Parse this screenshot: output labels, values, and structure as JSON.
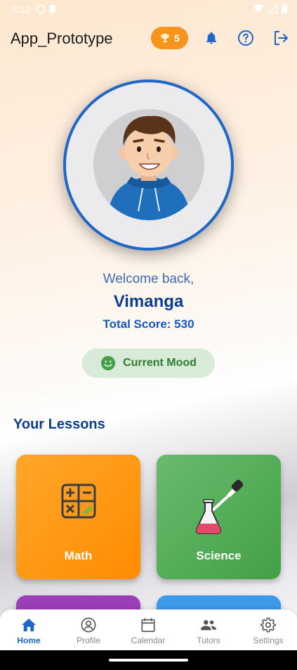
{
  "status_bar": {
    "time": "6:12"
  },
  "app_bar": {
    "title": "App_Prototype",
    "trophy_count": "5"
  },
  "profile": {
    "welcome_text": "Welcome back,",
    "username": "Vimanga",
    "total_score": "Total Score: 530"
  },
  "mood": {
    "label": "Current Mood"
  },
  "lessons": {
    "section_title": "Your Lessons",
    "items": [
      {
        "label": "Math",
        "color": "#ff9800"
      },
      {
        "label": "Science",
        "color": "#4caf50"
      }
    ]
  },
  "bottom_nav": {
    "items": [
      {
        "label": "Home",
        "icon": "home-icon",
        "active": true
      },
      {
        "label": "Profile",
        "icon": "account-circle-icon"
      },
      {
        "label": "Calendar",
        "icon": "calendar-icon"
      },
      {
        "label": "Tutors",
        "icon": "people-icon"
      },
      {
        "label": "Settings",
        "icon": "gear-icon"
      }
    ]
  },
  "colors": {
    "accent_blue": "#1e66c8",
    "heading_blue": "#0c3d91",
    "trophy_orange": "#f7941d",
    "mood_green": "#2e7d32"
  }
}
